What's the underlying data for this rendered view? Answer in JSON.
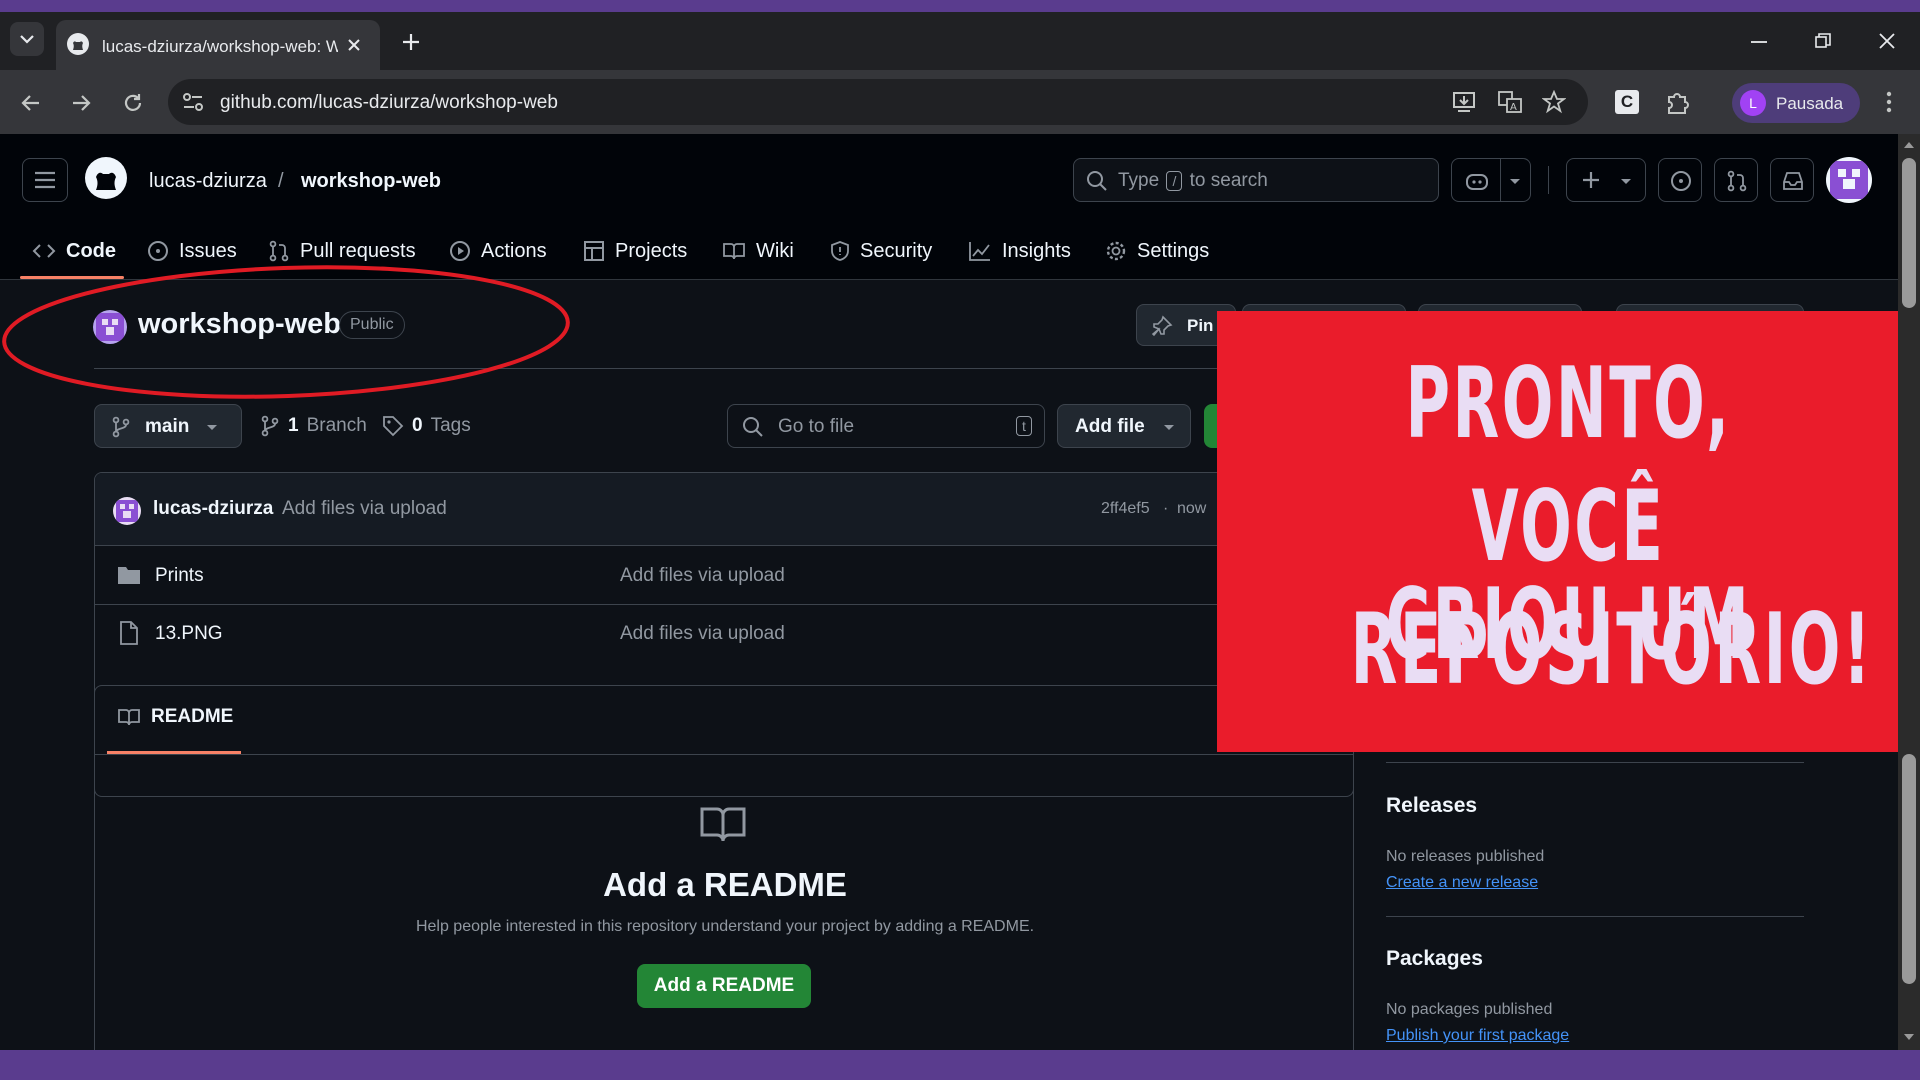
{
  "browser": {
    "tab_title": "lucas-dziurza/workshop-web: W",
    "url": "github.com/lucas-dziurza/workshop-web",
    "profile_initial": "L",
    "profile_name": "Pausada"
  },
  "header": {
    "owner": "lucas-dziurza",
    "separator": "/",
    "repo": "workshop-web",
    "search_prefix": "Type",
    "search_key": "/",
    "search_suffix": "to search"
  },
  "nav": [
    {
      "label": "Code",
      "icon": "code-icon"
    },
    {
      "label": "Issues",
      "icon": "issue-icon"
    },
    {
      "label": "Pull requests",
      "icon": "pull-request-icon"
    },
    {
      "label": "Actions",
      "icon": "play-icon"
    },
    {
      "label": "Projects",
      "icon": "table-icon"
    },
    {
      "label": "Wiki",
      "icon": "book-icon"
    },
    {
      "label": "Security",
      "icon": "shield-icon"
    },
    {
      "label": "Insights",
      "icon": "graph-icon"
    },
    {
      "label": "Settings",
      "icon": "gear-icon"
    }
  ],
  "repo": {
    "name": "workshop-web",
    "visibility": "Public",
    "pin_label": "Pin"
  },
  "branchbar": {
    "branch": "main",
    "branch_count": "1",
    "branch_label": "Branch",
    "tag_count": "0",
    "tag_label": "Tags",
    "goto_placeholder": "Go to file",
    "goto_key": "t",
    "add_file": "Add file"
  },
  "commit": {
    "author": "lucas-dziurza",
    "message": "Add files via upload",
    "hash": "2ff4ef5",
    "time": "now"
  },
  "files": [
    {
      "name": "Prints",
      "type": "folder",
      "message": "Add files via upload"
    },
    {
      "name": "13.PNG",
      "type": "file",
      "message": "Add files via upload"
    }
  ],
  "readme": {
    "tab": "README",
    "title": "Add a README",
    "description": "Help people interested in this repository understand your project by adding a README.",
    "button": "Add a README"
  },
  "sidebar": {
    "releases_title": "Releases",
    "releases_text": "No releases published",
    "releases_link": "Create a new release",
    "packages_title": "Packages",
    "packages_text": "No packages published",
    "packages_link": "Publish your first package"
  },
  "overlay": {
    "line1": "PRONTO,",
    "line2": "VOCÊ CRIOU UM",
    "line3": "REPOSITÓRIO!"
  },
  "colors": {
    "frame_purple": "#5a3c8e",
    "overlay_red": "#ea1c2b",
    "annotation_ellipse": "#e01b24",
    "github_bg": "#0d1117",
    "green_button": "#238636",
    "tab_underline": "#f78166"
  }
}
